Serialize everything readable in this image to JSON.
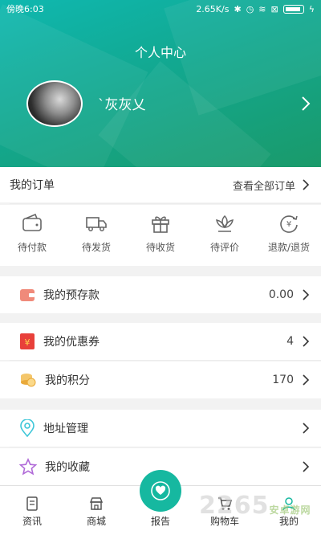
{
  "statusbar": {
    "time": "傍晚6:03",
    "speed": "2.65K/s"
  },
  "header": {
    "title": "个人中心",
    "username": "`灰灰乂"
  },
  "orders": {
    "title": "我的订单",
    "view_all": "查看全部订单",
    "items": [
      {
        "label": "待付款",
        "icon": "wallet-icon"
      },
      {
        "label": "待发货",
        "icon": "truck-icon"
      },
      {
        "label": "待收货",
        "icon": "gift-icon"
      },
      {
        "label": "待评价",
        "icon": "flower-icon"
      },
      {
        "label": "退款/退货",
        "icon": "refund-icon"
      }
    ]
  },
  "deposit": {
    "label": "我的预存款",
    "value": "0.00"
  },
  "coupons": {
    "label": "我的优惠券",
    "value": "4"
  },
  "points": {
    "label": "我的积分",
    "value": "170"
  },
  "address": {
    "label": "地址管理"
  },
  "favorites": {
    "label": "我的收藏"
  },
  "tabbar": {
    "news": "资讯",
    "mall": "商城",
    "report": "报告",
    "cart": "购物车",
    "mine": "我的"
  },
  "watermark": {
    "text": "2265",
    "sub": "安卓游网"
  },
  "colors": {
    "accent": "#16b8a0"
  }
}
